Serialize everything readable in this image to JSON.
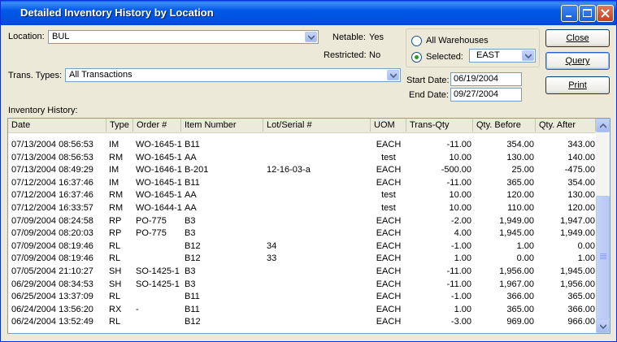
{
  "window": {
    "title": "Detailed Inventory History by Location"
  },
  "filters": {
    "location_label": "Location:",
    "location_value": "BUL",
    "netable_label": "Netable:",
    "netable_value": "Yes",
    "restricted_label": "Restricted:",
    "restricted_value": "No",
    "trans_types_label": "Trans. Types:",
    "trans_types_value": "All Transactions"
  },
  "warehouses": {
    "all_label": "All Warehouses",
    "selected_label": "Selected:",
    "selected_value": "EAST",
    "selected_option": "selected"
  },
  "dates": {
    "start_label": "Start Date:",
    "start_value": "06/19/2004",
    "end_label": "End Date:",
    "end_value": "09/27/2004"
  },
  "buttons": {
    "close": "Close",
    "query": "Query",
    "print": "Print"
  },
  "history": {
    "label": "Inventory History:",
    "columns": [
      "Date",
      "Type",
      "Order #",
      "Item Number",
      "Lot/Serial #",
      "UOM",
      "Trans-Qty",
      "Qty. Before",
      "Qty. After"
    ],
    "rows": [
      [
        "07/13/2004 08:56:53",
        "IM",
        "WO-1645-1",
        "B11",
        "",
        "EACH",
        "-11.00",
        "354.00",
        "343.00"
      ],
      [
        "07/13/2004 08:56:53",
        "RM",
        "WO-1645-1",
        "AA",
        "",
        "test",
        "10.00",
        "130.00",
        "140.00"
      ],
      [
        "07/13/2004 08:49:29",
        "IM",
        "WO-1646-1",
        "B-201",
        "12-16-03-a",
        "EACH",
        "-500.00",
        "25.00",
        "-475.00"
      ],
      [
        "07/12/2004 16:37:46",
        "IM",
        "WO-1645-1",
        "B11",
        "",
        "EACH",
        "-11.00",
        "365.00",
        "354.00"
      ],
      [
        "07/12/2004 16:37:46",
        "RM",
        "WO-1645-1",
        "AA",
        "",
        "test",
        "10.00",
        "120.00",
        "130.00"
      ],
      [
        "07/12/2004 16:33:57",
        "RM",
        "WO-1644-1",
        "AA",
        "",
        "test",
        "10.00",
        "110.00",
        "120.00"
      ],
      [
        "07/09/2004 08:24:58",
        "RP",
        "PO-775",
        "B3",
        "",
        "EACH",
        "-2.00",
        "1,949.00",
        "1,947.00"
      ],
      [
        "07/09/2004 08:20:03",
        "RP",
        "PO-775",
        "B3",
        "",
        "EACH",
        "4.00",
        "1,945.00",
        "1,949.00"
      ],
      [
        "07/09/2004 08:19:46",
        "RL",
        "",
        "B12",
        "34",
        "EACH",
        "-1.00",
        "1.00",
        "0.00"
      ],
      [
        "07/09/2004 08:19:46",
        "RL",
        "",
        "B12",
        "33",
        "EACH",
        "1.00",
        "0.00",
        "1.00"
      ],
      [
        "07/05/2004 21:10:27",
        "SH",
        "SO-1425-1",
        "B3",
        "",
        "EACH",
        "-11.00",
        "1,956.00",
        "1,945.00"
      ],
      [
        "06/29/2004 08:34:53",
        "SH",
        "SO-1425-1",
        "B3",
        "",
        "EACH",
        "-11.00",
        "1,967.00",
        "1,956.00"
      ],
      [
        "06/25/2004 13:37:09",
        "RL",
        "",
        "B11",
        "",
        "EACH",
        "-1.00",
        "366.00",
        "365.00"
      ],
      [
        "06/24/2004 13:56:20",
        "RX",
        "-",
        "B11",
        "",
        "EACH",
        "1.00",
        "365.00",
        "366.00"
      ],
      [
        "06/24/2004 13:52:49",
        "RL",
        "",
        "B12",
        "",
        "EACH",
        "-3.00",
        "969.00",
        "966.00"
      ]
    ]
  },
  "icons": {
    "minimize": "minimize-icon",
    "maximize": "maximize-icon",
    "close": "close-icon",
    "dropdown": "chevron-down-icon",
    "scroll_up": "scroll-up-icon",
    "scroll_down": "scroll-down-icon"
  },
  "colors": {
    "titlebar": "#0058e6",
    "window_bg": "#ece9d8",
    "close_button": "#c9401e",
    "radio_dot": "#21a121"
  }
}
